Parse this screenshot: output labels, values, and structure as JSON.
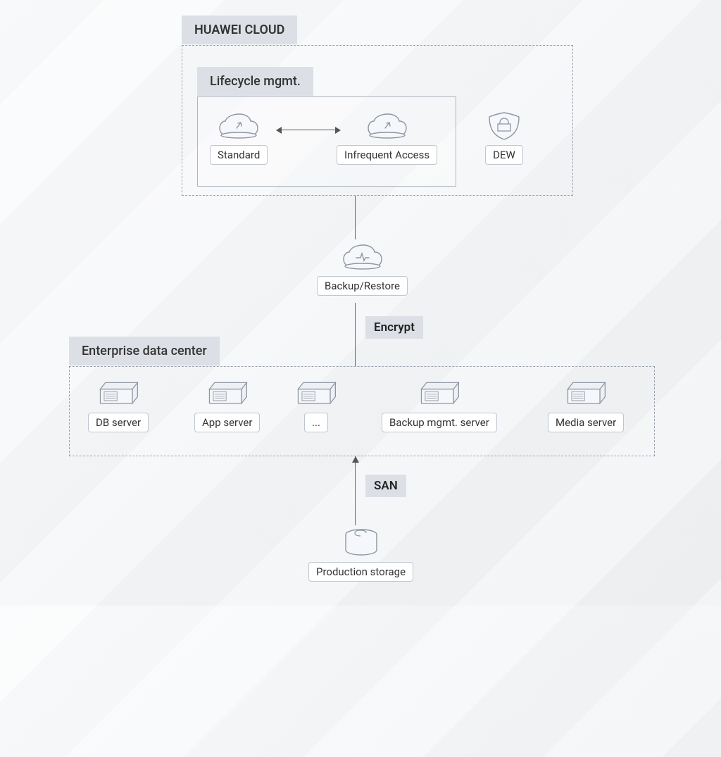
{
  "sections": {
    "cloud_title": "HUAWEI CLOUD",
    "lifecycle_title": "Lifecycle mgmt.",
    "enterprise_title": "Enterprise data center"
  },
  "nodes": {
    "standard": "Standard",
    "infrequent": "Infrequent Access",
    "dew": "DEW",
    "backup_restore": "Backup/Restore",
    "db_server": "DB server",
    "app_server": "App server",
    "ellipsis": "...",
    "backup_mgmt_server": "Backup mgmt. server",
    "media_server": "Media server",
    "production_storage": "Production storage"
  },
  "edges": {
    "encrypt": "Encrypt",
    "san": "SAN"
  }
}
